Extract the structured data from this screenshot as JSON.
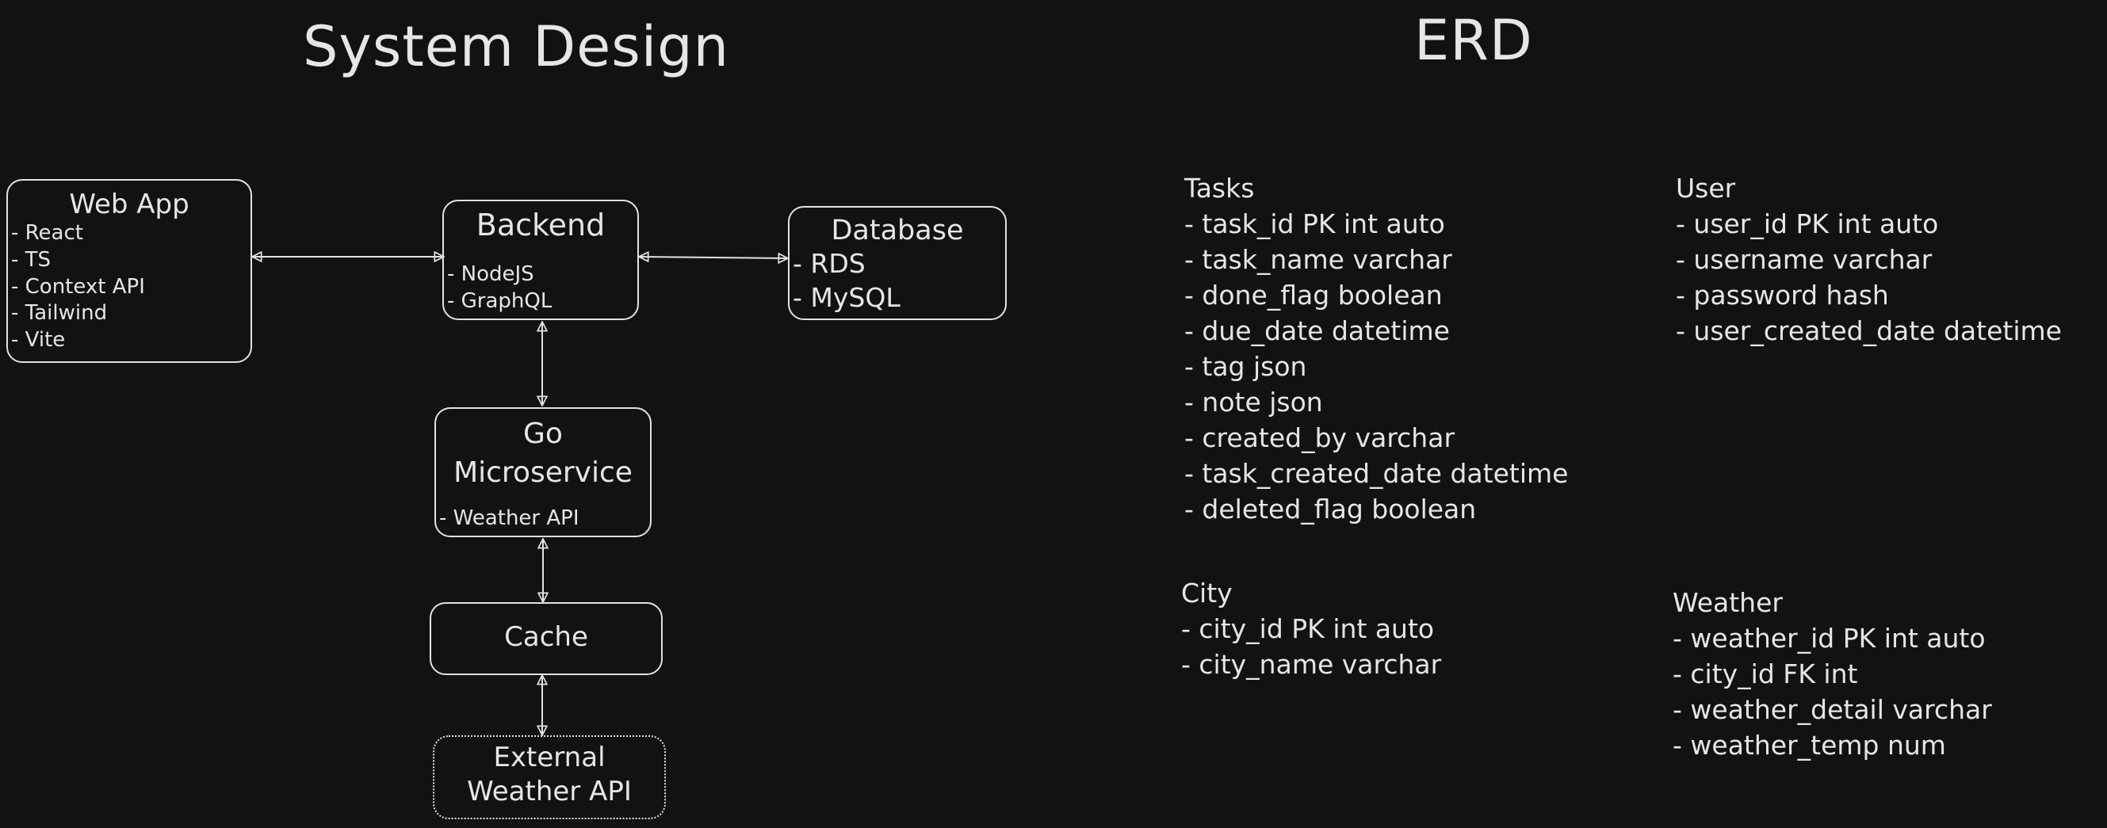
{
  "system_design": {
    "title": "System Design",
    "nodes": {
      "web_app": {
        "title": "Web App",
        "items": [
          "- React",
          "- TS",
          "- Context API",
          "- Tailwind",
          "- Vite"
        ]
      },
      "backend": {
        "title": "Backend",
        "items": [
          "- NodeJS",
          "- GraphQL"
        ]
      },
      "database": {
        "title": "Database",
        "items": [
          "- RDS",
          "- MySQL"
        ]
      },
      "go_microservice": {
        "title_lines": [
          "Go",
          "Microservice"
        ],
        "items": [
          "- Weather API"
        ]
      },
      "cache": {
        "title": "Cache"
      },
      "external": {
        "title_lines": [
          "External",
          "Weather API"
        ]
      }
    }
  },
  "erd": {
    "title": "ERD",
    "tasks": {
      "name": "Tasks",
      "fields": [
        "- task_id PK int auto",
        "- task_name varchar",
        "- done_flag boolean",
        "- due_date datetime",
        "- tag json",
        "- note json",
        "- created_by varchar",
        "- task_created_date datetime",
        "- deleted_flag boolean"
      ]
    },
    "user": {
      "name": "User",
      "fields": [
        "- user_id PK int auto",
        "- username varchar",
        "- password hash",
        "- user_created_date datetime"
      ]
    },
    "city": {
      "name": "City",
      "fields": [
        "- city_id PK int auto",
        "- city_name varchar"
      ]
    },
    "weather": {
      "name": "Weather",
      "fields": [
        "- weather_id PK int auto",
        "- city_id FK int",
        "- weather_detail varchar",
        "- weather_temp num"
      ]
    }
  }
}
